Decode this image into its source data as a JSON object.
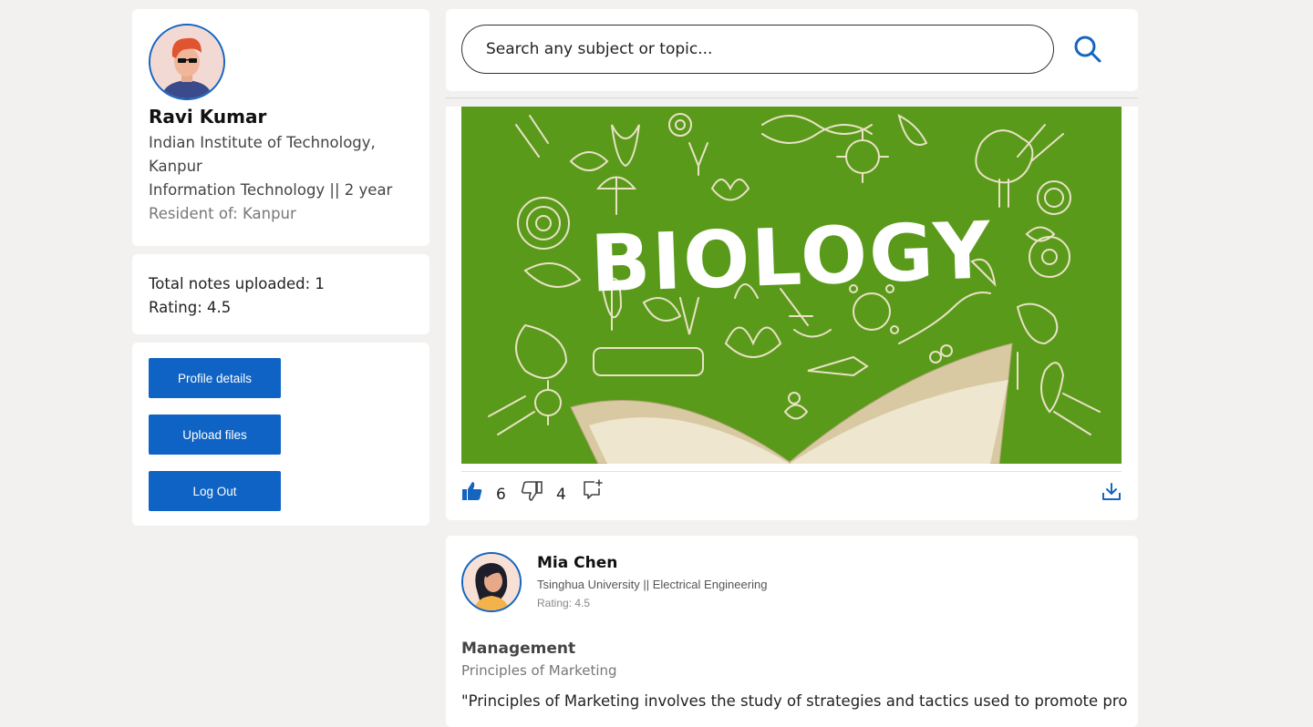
{
  "profile": {
    "name": "Ravi Kumar",
    "institute_line1": "Indian Institute of Technology,",
    "institute_line2": "Kanpur",
    "program": "Information Technology || 2 year",
    "resident": "Resident of: Kanpur"
  },
  "stats": {
    "total_notes": "Total notes uploaded: 1",
    "rating": "Rating: 4.5"
  },
  "actions": {
    "profile_details": "Profile details",
    "upload_files": "Upload files",
    "log_out": "Log Out"
  },
  "search": {
    "placeholder": "Search any subject or topic..."
  },
  "post": {
    "image_title": "BIOLOGY",
    "likes": "6",
    "dislikes": "4"
  },
  "post2": {
    "author": "Mia Chen",
    "university": "Tsinghua University || Electrical Engineering",
    "rating": "Rating: 4.5",
    "subject": "Management",
    "topic": "Principles of Marketing",
    "description": "\"Principles of Marketing involves the study of strategies and tactics used to promote products"
  },
  "colors": {
    "accent": "#0f63c4",
    "page_bg": "#f2f1f0",
    "image_bg": "#5a9a1b"
  },
  "icons": [
    "search-icon",
    "thumbs-up-icon",
    "thumbs-down-icon",
    "comment-add-icon",
    "download-icon"
  ]
}
